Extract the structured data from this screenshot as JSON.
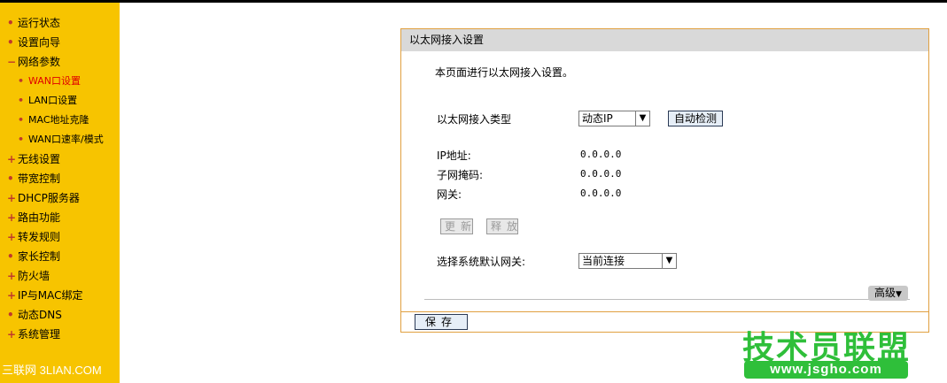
{
  "sidebar": {
    "items": [
      {
        "label": "运行状态",
        "bullet": "•"
      },
      {
        "label": "设置向导",
        "bullet": "•"
      },
      {
        "label": "网络参数",
        "bullet": "−"
      },
      {
        "label": "WAN口设置",
        "bullet": "•"
      },
      {
        "label": "LAN口设置",
        "bullet": "•"
      },
      {
        "label": "MAC地址克隆",
        "bullet": "•"
      },
      {
        "label": "WAN口速率/模式",
        "bullet": "•"
      },
      {
        "label": "无线设置",
        "bullet": "+"
      },
      {
        "label": "带宽控制",
        "bullet": "•"
      },
      {
        "label": "DHCP服务器",
        "bullet": "+"
      },
      {
        "label": "路由功能",
        "bullet": "+"
      },
      {
        "label": "转发规则",
        "bullet": "+"
      },
      {
        "label": "家长控制",
        "bullet": "•"
      },
      {
        "label": "防火墙",
        "bullet": "+"
      },
      {
        "label": "IP与MAC绑定",
        "bullet": "+"
      },
      {
        "label": "动态DNS",
        "bullet": "•"
      },
      {
        "label": "系统管理",
        "bullet": "+"
      }
    ],
    "watermark": "三联网 3LIAN.COM"
  },
  "panel": {
    "title": "以太网接入设置",
    "description": "本页面进行以太网接入设置。",
    "type_label": "以太网接入类型",
    "type_value": "动态IP",
    "auto_detect": "自动检测",
    "ip_label": "IP地址:",
    "ip_value": "0.0.0.0",
    "mask_label": "子网掩码:",
    "mask_value": "0.0.0.0",
    "gateway_label": "网关:",
    "gateway_value": "0.0.0.0",
    "renew": "更新",
    "release": "释放",
    "default_gw_label": "选择系统默认网关:",
    "default_gw_value": "当前连接",
    "advanced": "高级",
    "save": "保存"
  },
  "logo": {
    "main": "技术员联盟",
    "url": "www.jsgho.com"
  },
  "colors": {
    "sidebar": "#f7c400",
    "active": "#e00000",
    "panel_border": "#e0a040",
    "logo": "#2fbf3a"
  }
}
